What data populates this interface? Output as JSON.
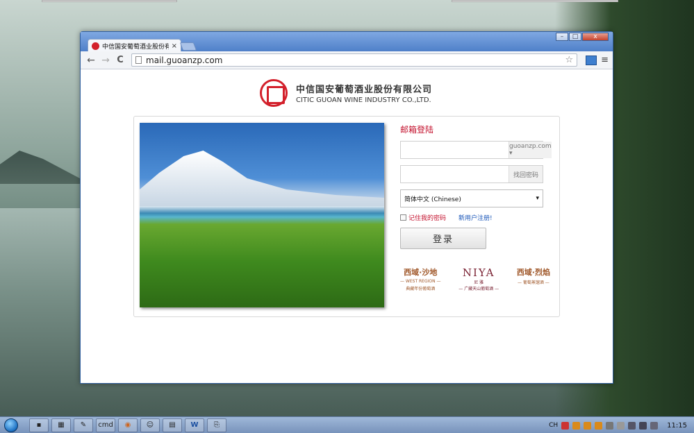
{
  "browser": {
    "tab_title": "中信国安葡萄酒业股份有限",
    "tab_close": "×",
    "url": "mail.guoanzp.com",
    "win_minimize": "–",
    "win_maximize": "□",
    "win_close": "x",
    "back_glyph": "←",
    "forward_glyph": "→",
    "reload_glyph": "C",
    "star_glyph": "☆",
    "menu_glyph": "≡"
  },
  "logo": {
    "cn": "中信国安葡萄酒业股份有限公司",
    "en": "CITIC GUOAN WINE INDUSTRY CO.,LTD."
  },
  "login": {
    "title": "邮箱登陆",
    "email_domain": "guoanzp.com ▾",
    "find_password": "找回密码",
    "language": "简体中文 (Chinese)",
    "language_arrow": "▾",
    "remember": "记住我的密码",
    "register": "新用户注册!",
    "submit": "登录"
  },
  "brands": [
    {
      "main": "西域·沙地",
      "sub1": "— WEST REGION —",
      "sub2": "典藏年份葡萄酒"
    },
    {
      "main": "NIYA",
      "sub1": "尼 雅",
      "sub2": "— 广藏天山葡萄酒 —"
    },
    {
      "main": "西域·烈焰",
      "sub1": "— 葡萄蒸馏酒 —",
      "sub2": ""
    }
  ],
  "taskbar": {
    "items": [
      "▪",
      "▦",
      "✎",
      "cmd",
      "◉",
      "☺",
      "▤",
      "W",
      "⎘"
    ],
    "tray_lang": "CH",
    "clock": "11:15"
  },
  "colors": {
    "accent_red": "#c3102c",
    "link_blue": "#1a56b8",
    "citic_red": "#d3202b",
    "brand_brown": "#a0582a"
  },
  "icons": {
    "favicon": "citic-logo-icon",
    "page": "page-icon",
    "extension": "extension-icon"
  }
}
